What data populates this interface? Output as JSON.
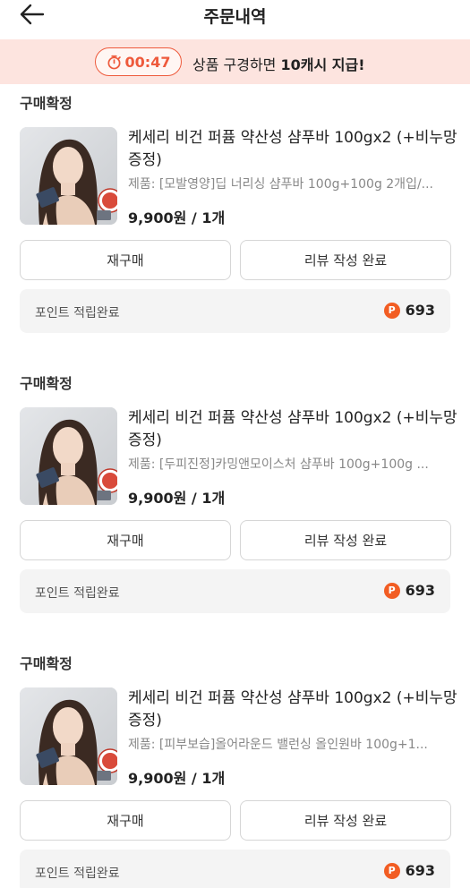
{
  "header": {
    "title": "주문내역",
    "back_icon": "arrow-left-icon"
  },
  "promo": {
    "timer": "00:47",
    "timer_icon": "stopwatch-icon",
    "text_prefix": "상품 구경하면 ",
    "text_bold": "10캐시 지급!"
  },
  "orders": [
    {
      "status": "구매확정",
      "product_name": "케세리 비건 퍼퓸 약산성 샴푸바 100gx2 (+비누망 증정)",
      "option": "제품: [모발영양]딥 너리싱 샴푸바 100g+100g 2개입/...",
      "badge_text": "모발영양",
      "price": "9,900원 / 1개",
      "rebuy_label": "재구매",
      "review_label": "리뷰 작성 완료",
      "points_label": "포인트 적립완료",
      "points_value": "693",
      "points_icon": "P"
    },
    {
      "status": "구매확정",
      "product_name": "케세리 비건 퍼퓸 약산성 샴푸바 100gx2 (+비누망 증정)",
      "option": "제품: [두피진정]카밍앤모이스처 샴푸바 100g+100g ...",
      "badge_text": "두피진정",
      "price": "9,900원 / 1개",
      "rebuy_label": "재구매",
      "review_label": "리뷰 작성 완료",
      "points_label": "포인트 적립완료",
      "points_value": "693",
      "points_icon": "P"
    },
    {
      "status": "구매확정",
      "product_name": "케세리 비건 퍼퓸 약산성 샴푸바 100gx2 (+비누망 증정)",
      "option": "제품: [피부보습]올어라운드 밸런싱 올인원바 100g+1...",
      "badge_text": "피부보습",
      "price": "9,900원 / 1개",
      "rebuy_label": "재구매",
      "review_label": "리뷰 작성 완료",
      "points_label": "포인트 적립완료",
      "points_value": "693",
      "points_icon": "P"
    }
  ],
  "colors": {
    "accent": "#ee5a3c",
    "promo_bg": "#fde4df",
    "points_icon": "#f25d23"
  }
}
